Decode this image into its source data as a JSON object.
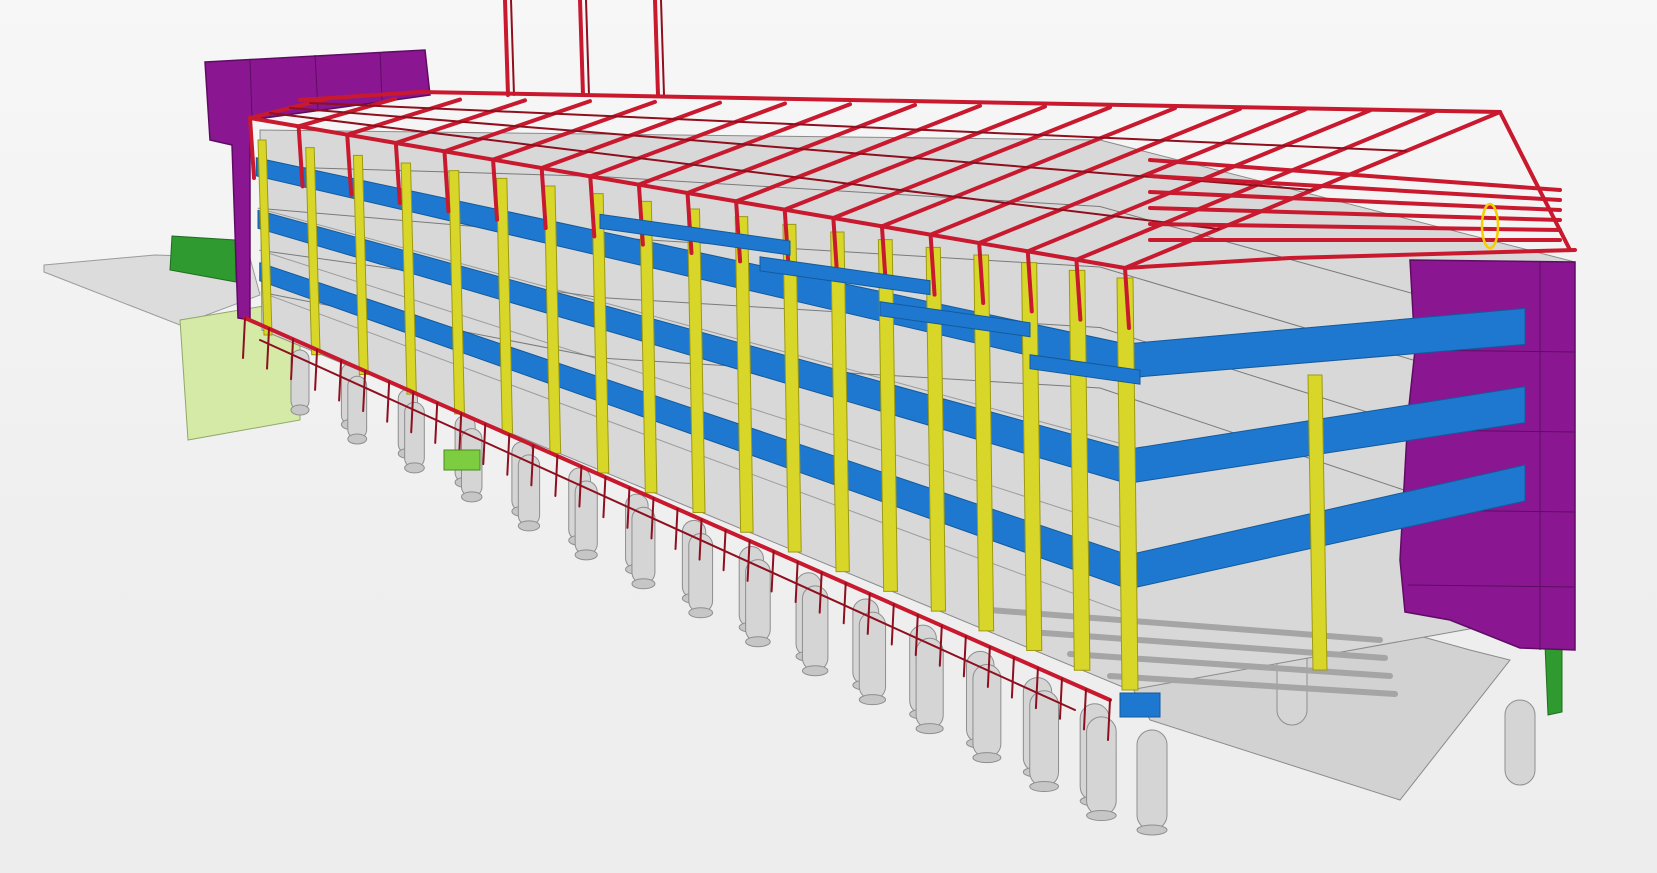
{
  "viewport": {
    "name": "3d-model-viewport",
    "background": "#f0f0f0"
  },
  "model": {
    "element_colors": {
      "steel_frame": "#c8192e",
      "steel_frame_dark": "#8e0f1e",
      "beams_blue": "#1f78cf",
      "beams_blue_dark": "#135a9c",
      "columns_yellow": "#d9d62a",
      "columns_yellow_dark": "#9d9a12",
      "cores_purple": "#8a1791",
      "cores_purple_dark": "#5e0c63",
      "slabs_grey": "#c9c9c9",
      "slab_lines": "#7a7a7a",
      "piles_grey": "#d5d5d5",
      "ramp_light_green": "#d4eaa6",
      "green_element": "#2f9a2f",
      "highlight_yellow": "#f4d000"
    },
    "floor_levels": 3,
    "frame_bays": 18,
    "pile_count": 30
  }
}
